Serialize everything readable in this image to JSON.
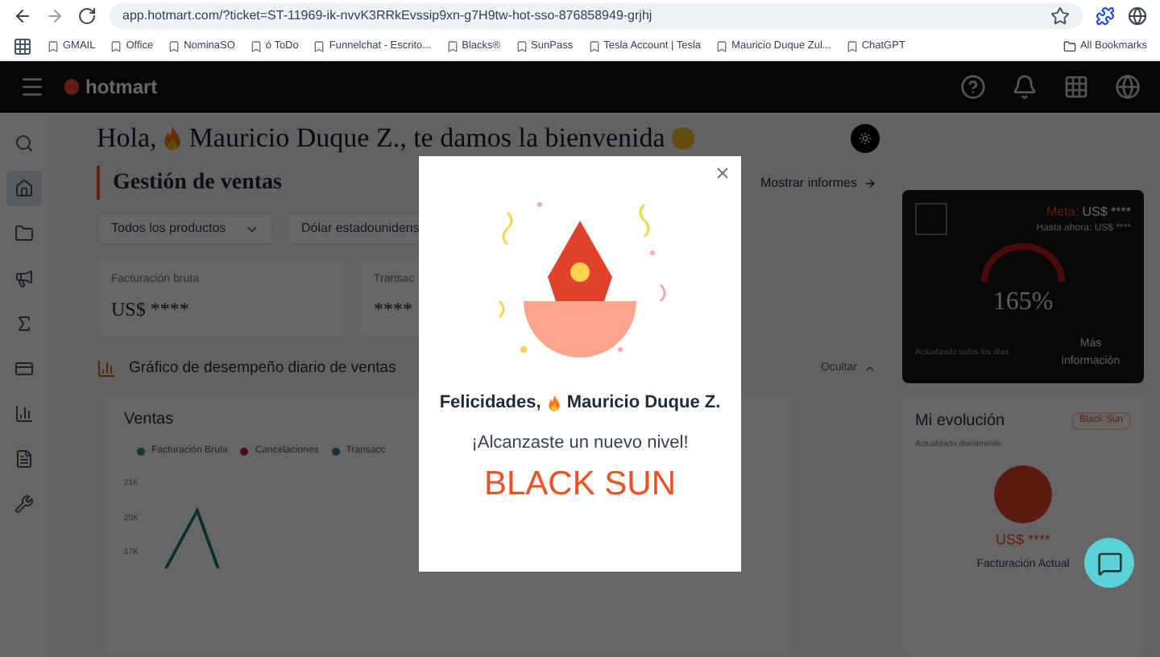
{
  "browser": {
    "url": "app.hotmart.com/?ticket=ST-11969-ik-nvvK3RRkEvssip9xn-g7H9tw-hot-sso-876858949-grjhj",
    "bookmarks": [
      {
        "label": "GMAIL"
      },
      {
        "label": "Office"
      },
      {
        "label": "NominaSO"
      },
      {
        "label": "ó ToDo"
      },
      {
        "label": "Funnelchat - Escrito..."
      },
      {
        "label": "Blacks®"
      },
      {
        "label": "SunPass"
      },
      {
        "label": "Tesla Account | Tesla"
      },
      {
        "label": "Mauricio Duque Zul..."
      },
      {
        "label": "ChatGPT"
      }
    ],
    "all_bookmarks": "All Bookmarks"
  },
  "header": {
    "logo": "hotmart"
  },
  "sidebar": {
    "items": [
      {
        "kind": "search",
        "selected": false
      },
      {
        "kind": "home",
        "selected": true
      },
      {
        "kind": "folder",
        "selected": false
      },
      {
        "kind": "megaphone",
        "selected": false
      },
      {
        "kind": "sigma",
        "selected": false
      },
      {
        "kind": "card",
        "selected": false
      },
      {
        "kind": "chart",
        "selected": false
      },
      {
        "kind": "document",
        "selected": false
      },
      {
        "kind": "tools",
        "selected": false
      }
    ]
  },
  "greeting": "Hola,",
  "greeting_name": "Mauricio Duque Z., te damos la bienvenida",
  "sales": {
    "title": "Gestión de ventas",
    "reports_link": "Mostrar informes",
    "filters": [
      {
        "value": "Todos los productos"
      },
      {
        "value": "Dólar estadounidens"
      }
    ],
    "stats": [
      {
        "label": "Facturación bruta",
        "value": "US$ ****"
      },
      {
        "label": "Transac",
        "value": "****"
      }
    ]
  },
  "chart_section": {
    "title": "Gráfico de desempeño diario de ventas",
    "toggle": "Ocultar",
    "card_title": "Ventas",
    "legend": [
      {
        "label": "Facturación Bruta",
        "color": "#0c3a37"
      },
      {
        "label": "Cancelaciones",
        "color": "#4a1010"
      },
      {
        "label": "Transacc",
        "color": "#0b3540"
      }
    ],
    "y_labels": [
      "21K",
      "20K",
      "17K"
    ]
  },
  "goal_card": {
    "meta_label": "Meta:",
    "meta_value": "US$ ****",
    "so_far": "Hasta ahora: US$ ****",
    "percent": "165%",
    "updated": "Actualizado todos los días",
    "more": "Más información"
  },
  "evolution": {
    "title": "Mi evolución",
    "badge": "Black Sun",
    "subtitle": "Actualizado diariamente",
    "value": "US$ ****",
    "value_label": "Facturación Actual"
  },
  "modal": {
    "title_prefix": "Felicidades,",
    "title_name": "Mauricio Duque Z.",
    "subtitle": "¡Alcanzaste un nuevo nivel!",
    "level": "BLACK SUN"
  }
}
